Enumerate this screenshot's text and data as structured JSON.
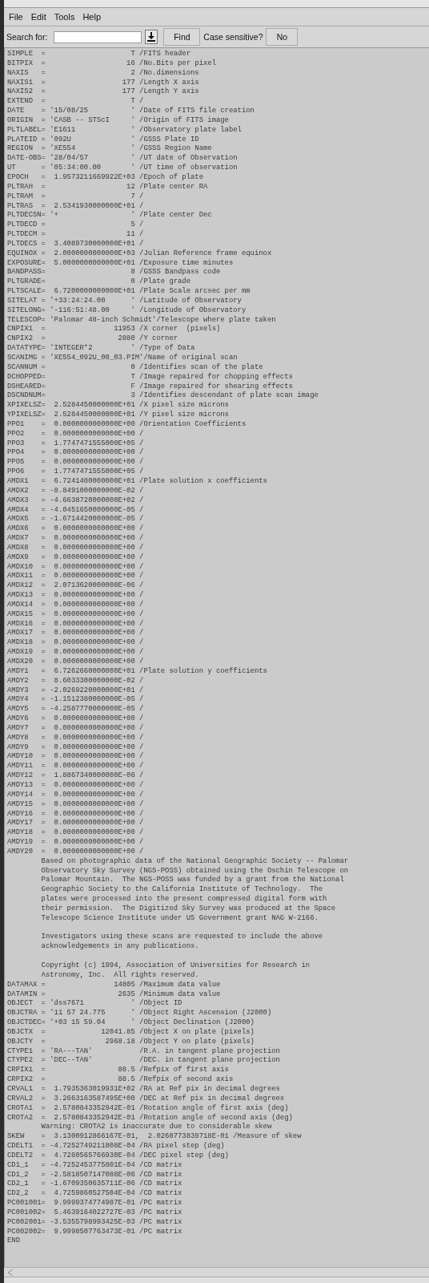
{
  "menu": [
    {
      "label": "File"
    },
    {
      "label": "Edit"
    },
    {
      "label": "Tools"
    },
    {
      "label": "Help"
    }
  ],
  "toolbar": {
    "search_label": "Search for:",
    "find_button": "Find",
    "case_label": "Case sensitive?",
    "case_button": "No"
  },
  "header": [
    {
      "kind": "card",
      "text": "SIMPLE  =                    T /FITS header"
    },
    {
      "kind": "card",
      "text": "BITPIX  =                   16 /No.Bits per pixel"
    },
    {
      "kind": "card",
      "text": "NAXIS   =                    2 /No.dimensions"
    },
    {
      "kind": "card",
      "text": "NAXIS1  =                  177 /Length X axis"
    },
    {
      "kind": "card",
      "text": "NAXIS2  =                  177 /Length Y axis"
    },
    {
      "kind": "card",
      "text": "EXTEND  =                    T /"
    },
    {
      "kind": "card",
      "text": "DATE    = '15/08/25          ' /Date of FITS file creation"
    },
    {
      "kind": "card",
      "text": "ORIGIN  = 'CASB -- STScI     ' /Origin of FITS image"
    },
    {
      "kind": "card",
      "text": "PLTLABEL= 'E1611             ' /Observatory plate label"
    },
    {
      "kind": "card",
      "text": "PLATEID = '092U              ' /GSSS Plate ID"
    },
    {
      "kind": "card",
      "text": "REGION  = 'XE554             ' /GSSS Region Name"
    },
    {
      "kind": "card",
      "text": "DATE-OBS= '28/04/57          ' /UT date of Observation"
    },
    {
      "kind": "card",
      "text": "UT      = '05:34:00.00       ' /UT time of observation"
    },
    {
      "kind": "card",
      "text": "EPOCH   =  1.9573211669922E+03 /Epoch of plate"
    },
    {
      "kind": "card",
      "text": "PLTRAH  =                   12 /Plate center RA"
    },
    {
      "kind": "card",
      "text": "PLTRAM  =                    7 /"
    },
    {
      "kind": "card",
      "text": "PLTRAS  =  2.5341930000000E+01 /"
    },
    {
      "kind": "card",
      "text": "PLTDECSN= '+                 ' /Plate center Dec"
    },
    {
      "kind": "card",
      "text": "PLTDECD =                    5 /"
    },
    {
      "kind": "card",
      "text": "PLTDECM =                   11 /"
    },
    {
      "kind": "card",
      "text": "PLTDECS =  3.4089730000000E+01 /"
    },
    {
      "kind": "card",
      "text": "EQUINOX =  2.0000000000000E+03 /Julian Reference frame equinox"
    },
    {
      "kind": "card",
      "text": "EXPOSURE=  5.0000000000000E+01 /Exposure time minutes"
    },
    {
      "kind": "card",
      "text": "BANDPASS=                    8 /GSSS Bandpass code"
    },
    {
      "kind": "card",
      "text": "PLTGRADE=                    0 /Plate grade"
    },
    {
      "kind": "card",
      "text": "PLTSCALE=  6.7200000000000E+01 /Plate Scale arcsec per mm"
    },
    {
      "kind": "card",
      "text": "SITELAT = '+33:24:24.00      ' /Latitude of Observatory"
    },
    {
      "kind": "card",
      "text": "SITELONG= '-116:51:48.00     ' /Longitude of Observatory"
    },
    {
      "kind": "card",
      "text": "TELESCOP= 'Palomar 48-inch Schmidt'/Telescope where plate taken"
    },
    {
      "kind": "card",
      "text": "CNPIX1  =                11953 /X corner  (pixels)"
    },
    {
      "kind": "card",
      "text": "CNPIX2  =                 2880 /Y corner"
    },
    {
      "kind": "card",
      "text": "DATATYPE= 'INTEGER*2         ' /Type of Data"
    },
    {
      "kind": "card",
      "text": "SCANIMG = 'XE554_092U_00_03.PIM'/Name of original scan"
    },
    {
      "kind": "card",
      "text": "SCANNUM =                    0 /Identifies scan of the plate"
    },
    {
      "kind": "card",
      "text": "DCHOPPED=                    T /Image repaired for chopping effects"
    },
    {
      "kind": "card",
      "text": "DSHEARED=                    F /Image repaired for shearing effects"
    },
    {
      "kind": "card",
      "text": "DSCNDNUM=                    3 /Identifies descendant of plate scan image"
    },
    {
      "kind": "card",
      "text": "XPIXELSZ=  2.5284450000000E+01 /X pixel size microns"
    },
    {
      "kind": "card",
      "text": "YPIXELSZ=  2.5284450000000E+01 /Y pixel size microns"
    },
    {
      "kind": "card",
      "text": "PPO1    =  0.0000000000000E+00 /Orientation Coefficients"
    },
    {
      "kind": "card",
      "text": "PPO2    =  0.0000000000000E+00 /"
    },
    {
      "kind": "card",
      "text": "PPO3    =  1.7747471555000E+05 /"
    },
    {
      "kind": "card",
      "text": "PPO4    =  0.0000000000000E+00 /"
    },
    {
      "kind": "card",
      "text": "PPO5    =  0.0000000000000E+00 /"
    },
    {
      "kind": "card",
      "text": "PPO6    =  1.7747471555000E+05 /"
    },
    {
      "kind": "card",
      "text": "AMDX1   =  6.7241400000000E+01 /Plate solution x coefficients"
    },
    {
      "kind": "card",
      "text": "AMDX2   = -8.8491000000000E-02 /"
    },
    {
      "kind": "card",
      "text": "AMDX3   = -4.6638720000000E+02 /"
    },
    {
      "kind": "card",
      "text": "AMDX4   = -4.0451650000000E-05 /"
    },
    {
      "kind": "card",
      "text": "AMDX5   = -1.6714420000000E-05 /"
    },
    {
      "kind": "card",
      "text": "AMDX6   =  0.0000000000000E+00 /"
    },
    {
      "kind": "card",
      "text": "AMDX7   =  0.0000000000000E+00 /"
    },
    {
      "kind": "card",
      "text": "AMDX8   =  0.0000000000000E+00 /"
    },
    {
      "kind": "card",
      "text": "AMDX9   =  0.0000000000000E+00 /"
    },
    {
      "kind": "card",
      "text": "AMDX10  =  0.0000000000000E+00 /"
    },
    {
      "kind": "card",
      "text": "AMDX11  =  0.0000000000000E+00 /"
    },
    {
      "kind": "card",
      "text": "AMDX12  =  2.0713620000000E-06 /"
    },
    {
      "kind": "card",
      "text": "AMDX13  =  0.0000000000000E+00 /"
    },
    {
      "kind": "card",
      "text": "AMDX14  =  0.0000000000000E+00 /"
    },
    {
      "kind": "card",
      "text": "AMDX15  =  0.0000000000000E+00 /"
    },
    {
      "kind": "card",
      "text": "AMDX16  =  0.0000000000000E+00 /"
    },
    {
      "kind": "card",
      "text": "AMDX17  =  0.0000000000000E+00 /"
    },
    {
      "kind": "card",
      "text": "AMDX18  =  0.0000000000000E+00 /"
    },
    {
      "kind": "card",
      "text": "AMDX19  =  0.0000000000000E+00 /"
    },
    {
      "kind": "card",
      "text": "AMDX20  =  0.0000000000000E+00 /"
    },
    {
      "kind": "card",
      "text": "AMDY1   =  6.7262660000000E+01 /Plate solution y coefficients"
    },
    {
      "kind": "card",
      "text": "AMDY2   =  8.6033300000000E-02 /"
    },
    {
      "kind": "card",
      "text": "AMDY3   = -2.0269220000000E+01 /"
    },
    {
      "kind": "card",
      "text": "AMDY4   = -1.1512380000000E-05 /"
    },
    {
      "kind": "card",
      "text": "AMDY5   = -4.2587770000000E-05 /"
    },
    {
      "kind": "card",
      "text": "AMDY6   =  0.0000000000000E+00 /"
    },
    {
      "kind": "card",
      "text": "AMDY7   =  0.0000000000000E+00 /"
    },
    {
      "kind": "card",
      "text": "AMDY8   =  0.0000000000000E+00 /"
    },
    {
      "kind": "card",
      "text": "AMDY9   =  0.0000000000000E+00 /"
    },
    {
      "kind": "card",
      "text": "AMDY10  =  0.0000000000000E+00 /"
    },
    {
      "kind": "card",
      "text": "AMDY11  =  0.0000000000000E+00 /"
    },
    {
      "kind": "card",
      "text": "AMDY12  =  1.8867340000000E-06 /"
    },
    {
      "kind": "card",
      "text": "AMDY13  =  0.0000000000000E+00 /"
    },
    {
      "kind": "card",
      "text": "AMDY14  =  0.0000000000000E+00 /"
    },
    {
      "kind": "card",
      "text": "AMDY15  =  0.0000000000000E+00 /"
    },
    {
      "kind": "card",
      "text": "AMDY16  =  0.0000000000000E+00 /"
    },
    {
      "kind": "card",
      "text": "AMDY17  =  0.0000000000000E+00 /"
    },
    {
      "kind": "card",
      "text": "AMDY18  =  0.0000000000000E+00 /"
    },
    {
      "kind": "card",
      "text": "AMDY19  =  0.0000000000000E+00 /"
    },
    {
      "kind": "card",
      "text": "AMDY20  =  0.0000000000000E+00 /"
    },
    {
      "kind": "paragraph",
      "lines": [
        "        Based on photographic data of the National Geographic Society -- Palomar",
        "        Observatory Sky Survey (NGS-POSS) obtained using the Oschin Telescope on",
        "        Palomar Mountain.  The NGS-POSS was funded by a grant from the National",
        "        Geographic Society to the California Institute of Technology.  The",
        "        plates were processed into the present compressed digital form with",
        "        their permission.  The Digitized Sky Survey was produced at the Space",
        "        Telescope Science Institute under US Government grant NAG W-2166."
      ]
    },
    {
      "kind": "paragraph",
      "lines": [
        "        Investigators using these scans are requested to include the above",
        "        acknowledgements in any publications."
      ]
    },
    {
      "kind": "paragraph",
      "lines": [
        "        Copyright (c) 1994, Association of Universities for Research in",
        "        Astronomy, Inc.  All rights reserved."
      ]
    },
    {
      "kind": "card",
      "text": "DATAMAX =                14805 /Maximum data value"
    },
    {
      "kind": "card",
      "text": "DATAMIN =                 2635 /Minimum data value"
    },
    {
      "kind": "card",
      "text": "OBJECT  = 'dss7671           ' /Object ID"
    },
    {
      "kind": "card",
      "text": "OBJCTRA = '11 57 24.775      ' /Object Right Ascension (J2000)"
    },
    {
      "kind": "card",
      "text": "OBJCTDEC= '+03 15 59.04      ' /Object Declination (J2000)"
    },
    {
      "kind": "card",
      "text": "OBJCTX  =             12041.85 /Object X on plate (pixels)"
    },
    {
      "kind": "card",
      "text": "OBJCTY  =              2968.18 /Object Y on plate (pixels)"
    },
    {
      "kind": "card",
      "text": "CTYPE1  = 'RA---TAN'           /R.A. in tangent plane projection"
    },
    {
      "kind": "card",
      "text": "CTYPE2  = 'DEC--TAN'           /DEC. in tangent plane projection"
    },
    {
      "kind": "card",
      "text": "CRPIX1  =                 88.5 /Refpix of first axis"
    },
    {
      "kind": "card",
      "text": "CRPIX2  =                 88.5 /Refpix of second axis"
    },
    {
      "kind": "card",
      "text": "CRVAL1  =  1.7935363019931E+02 /RA at Ref pix in decimal degrees"
    },
    {
      "kind": "card",
      "text": "CRVAL2  =  3.2663163587495E+00 /DEC at Ref pix in decimal degrees"
    },
    {
      "kind": "card",
      "text": "CROTA1  =  2.5780843352942E-01 /Rotation angle of first axis (deg)"
    },
    {
      "kind": "card",
      "text": "CROTA2  =  2.5780843352942E-01 /Rotation angle of second axis (deg)"
    },
    {
      "kind": "card",
      "text": "        Warning: CROTA2 is inaccurate due to considerable skew"
    },
    {
      "kind": "card",
      "text": "SKEW    =  3.1300912866167E-01,  2.0260773839718E-01 /Measure of skew"
    },
    {
      "kind": "card",
      "text": "CDELT1  = -4.7252749211808E-04 /RA pixel step (deg)"
    },
    {
      "kind": "card",
      "text": "CDELT2  =  4.7260565766930E-04 /DEC pixel step (deg)"
    },
    {
      "kind": "card",
      "text": "CD1_1   = -4.7252453775801E-04 /CD matrix"
    },
    {
      "kind": "card",
      "text": "CD1_2   = -2.5818507147088E-06 /CD matrix"
    },
    {
      "kind": "card",
      "text": "CD2_1   = -1.6709350635711E-06 /CD matrix"
    },
    {
      "kind": "card",
      "text": "CD2_2   =  4.7259860527504E-04 /CD matrix"
    },
    {
      "kind": "card",
      "text": "PC001001=  9.9999374774987E-01 /PC matrix"
    },
    {
      "kind": "card",
      "text": "PC001002=  5.4639164022727E-03 /PC matrix"
    },
    {
      "kind": "card",
      "text": "PC002001= -3.5355798993425E-03 /PC matrix"
    },
    {
      "kind": "card",
      "text": "PC002002=  9.9998507763473E-01 /PC matrix"
    },
    {
      "kind": "card",
      "text": "END"
    }
  ]
}
